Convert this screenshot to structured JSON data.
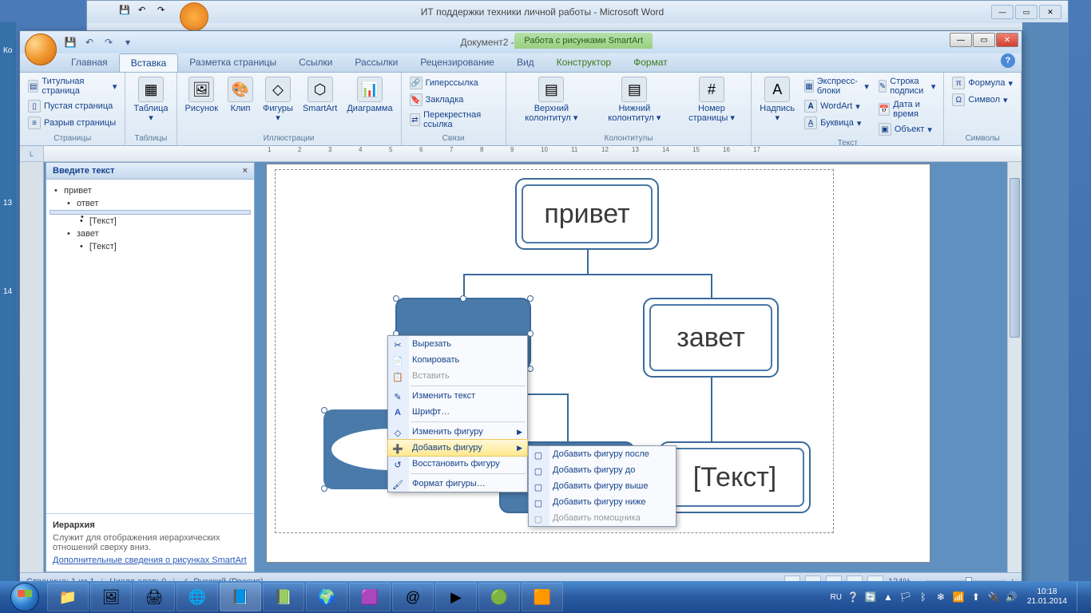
{
  "bgWindow": {
    "title": "ИТ поддержки техники личной работы - Microsoft Word"
  },
  "fgWindow": {
    "title": "Документ2 - Microsoft Word",
    "contextTab": "Работа с рисунками SmartArt"
  },
  "tabs": {
    "home": "Главная",
    "insert": "Вставка",
    "layout": "Разметка страницы",
    "refs": "Ссылки",
    "mail": "Рассылки",
    "review": "Рецензирование",
    "view": "Вид",
    "ctor": "Конструктор",
    "format": "Формат"
  },
  "ribbon": {
    "pages": {
      "label": "Страницы",
      "cover": "Титульная страница",
      "blank": "Пустая страница",
      "break": "Разрыв страницы"
    },
    "tables": {
      "label": "Таблицы",
      "table": "Таблица"
    },
    "illus": {
      "label": "Иллюстрации",
      "pic": "Рисунок",
      "clip": "Клип",
      "shapes": "Фигуры",
      "smartart": "SmartArt",
      "chart": "Диаграмма"
    },
    "links": {
      "label": "Связи",
      "hyper": "Гиперссылка",
      "bookmark": "Закладка",
      "xref": "Перекрестная ссылка"
    },
    "hf": {
      "label": "Колонтитулы",
      "header": "Верхний колонтитул",
      "footer": "Нижний колонтитул",
      "pagenum": "Номер страницы"
    },
    "text": {
      "label": "Текст",
      "textbox": "Надпись",
      "quickparts": "Экспресс-блоки",
      "wordart": "WordArt",
      "dropcap": "Буквица",
      "sigline": "Строка подписи",
      "datetime": "Дата и время",
      "object": "Объект"
    },
    "symbols": {
      "label": "Символы",
      "equation": "Формула",
      "symbol": "Символ"
    }
  },
  "textPane": {
    "title": "Введите текст",
    "items": {
      "i0": "привет",
      "i1": "ответ",
      "i2": "",
      "i3": "[Текст]",
      "i4": "завет",
      "i5": "[Текст]"
    },
    "footer": {
      "heading": "Иерархия",
      "desc": "Служит для отображения иерархических отношений сверху вниз.",
      "link": "Дополнительные сведения о рисунках SmartArt"
    }
  },
  "smartart": {
    "root": "привет",
    "child2": "завет",
    "leaf3": "[Текст]"
  },
  "contextMenu": {
    "cut": "Вырезать",
    "copy": "Копировать",
    "paste": "Вставить",
    "editText": "Изменить текст",
    "font": "Шрифт…",
    "changeShape": "Изменить фигуру",
    "addShape": "Добавить фигуру",
    "resetShape": "Восстановить фигуру",
    "formatShape": "Формат фигуры…"
  },
  "subMenu": {
    "after": "Добавить фигуру после",
    "before": "Добавить фигуру до",
    "above": "Добавить фигуру выше",
    "below": "Добавить фигуру ниже",
    "assistant": "Добавить помощника"
  },
  "statusBar": {
    "page": "Страница: 1 из 1",
    "words": "Число слов: 0",
    "lang": "Русский (Россия)",
    "zoom": "124%"
  },
  "tray": {
    "lang": "RU",
    "time": "10:18",
    "date": "21.01.2014"
  }
}
